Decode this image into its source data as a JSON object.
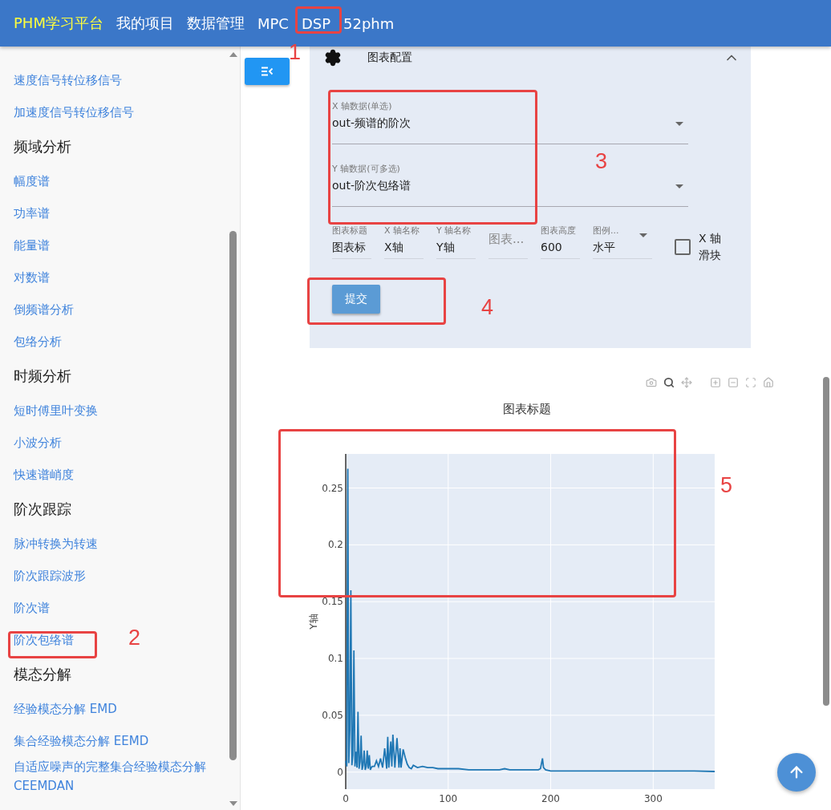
{
  "header": {
    "brand": "PHM学习平台",
    "nav": [
      {
        "label": "我的项目"
      },
      {
        "label": "数据管理"
      },
      {
        "label": "MPC"
      },
      {
        "label": "DSP"
      },
      {
        "label": "52phm"
      }
    ]
  },
  "sidebar": {
    "items": [
      {
        "kind": "link",
        "label": "速度信号转位移信号"
      },
      {
        "kind": "link",
        "label": "加速度信号转位移信号"
      },
      {
        "kind": "heading",
        "label": "频域分析"
      },
      {
        "kind": "link",
        "label": "幅度谱"
      },
      {
        "kind": "link",
        "label": "功率谱"
      },
      {
        "kind": "link",
        "label": "能量谱"
      },
      {
        "kind": "link",
        "label": "对数谱"
      },
      {
        "kind": "link",
        "label": "倒频谱分析"
      },
      {
        "kind": "link",
        "label": "包络分析"
      },
      {
        "kind": "heading",
        "label": "时频分析"
      },
      {
        "kind": "link",
        "label": "短时傅里叶变换"
      },
      {
        "kind": "link",
        "label": "小波分析"
      },
      {
        "kind": "link",
        "label": "快速谱峭度"
      },
      {
        "kind": "heading",
        "label": "阶次跟踪"
      },
      {
        "kind": "link",
        "label": "脉冲转换为转速"
      },
      {
        "kind": "link",
        "label": "阶次跟踪波形"
      },
      {
        "kind": "link",
        "label": "阶次谱"
      },
      {
        "kind": "link",
        "label": "阶次包络谱"
      },
      {
        "kind": "heading",
        "label": "模态分解"
      },
      {
        "kind": "link",
        "label": "经验模态分解 EMD"
      },
      {
        "kind": "link",
        "label": "集合经验模态分解 EEMD"
      },
      {
        "kind": "link",
        "label": "自适应噪声的完整集合经验模态分解 CEEMDAN"
      }
    ]
  },
  "config_panel": {
    "title": "图表配置",
    "expanded": true,
    "x_select": {
      "label": "X 轴数据(单选)",
      "value": "out-频谱的阶次"
    },
    "y_select": {
      "label": "Y 轴数据(可多选)",
      "value": "out-阶次包络谱"
    },
    "fields": [
      {
        "kind": "text",
        "label": "图表标题",
        "value": "图表标"
      },
      {
        "kind": "text",
        "label": "X 轴名称",
        "value": "X轴"
      },
      {
        "kind": "text",
        "label": "Y 轴名称",
        "value": "Y轴"
      },
      {
        "kind": "text",
        "label": "图表..."
      },
      {
        "kind": "text",
        "label": "图表高度",
        "value": "600"
      },
      {
        "kind": "select",
        "label": "图例...",
        "value": "水平"
      }
    ],
    "checkbox": {
      "label": "X 轴滑块",
      "checked": false
    },
    "submit": "提交"
  },
  "chart": {
    "chart_data": {
      "type": "line",
      "grid": true,
      "title": "图表标题",
      "ylabel": "Y轴",
      "xlim": [
        0,
        360
      ],
      "ylim": [
        -0.015,
        0.28
      ],
      "xticks": [
        0,
        100,
        200,
        300
      ],
      "yticks": [
        0,
        0.05,
        0.1,
        0.15,
        0.2,
        0.25
      ],
      "x": [
        0,
        1,
        2,
        3,
        4,
        5,
        6,
        7,
        8,
        9,
        10,
        11,
        12,
        13,
        14,
        15,
        16,
        17,
        18,
        19,
        20,
        21,
        22,
        23,
        24,
        25,
        26,
        28,
        30,
        32,
        34,
        36,
        38,
        40,
        41,
        42,
        44,
        45,
        46,
        48,
        50,
        52,
        53,
        54,
        56,
        58,
        60,
        62,
        64,
        66,
        70,
        75,
        80,
        85,
        90,
        100,
        110,
        120,
        130,
        140,
        150,
        155,
        160,
        170,
        180,
        188,
        190,
        192,
        193,
        195,
        200,
        210,
        220,
        240,
        260,
        280,
        300,
        320,
        340,
        360
      ],
      "series": [
        {
          "color": "#1f77b4",
          "values": [
            0.01,
            0.005,
            0.267,
            0.008,
            0.037,
            0.16,
            0.006,
            0.015,
            0.107,
            0.005,
            0.018,
            0.004,
            0.053,
            0.003,
            0.009,
            0.032,
            0.002,
            0.006,
            0.019,
            0.002,
            0.005,
            0.019,
            0.003,
            0.015,
            0.002,
            0.004,
            0.005,
            0.005,
            0.01,
            0.005,
            0.012,
            0.004,
            0.021,
            0.003,
            0.031,
            0.004,
            0.027,
            0.005,
            0.033,
            0.004,
            0.03,
            0.004,
            0.021,
            0.004,
            0.02,
            0.013,
            0.007,
            0.004,
            0.003,
            0.006,
            0.004,
            0.005,
            0.004,
            0.004,
            0.003,
            0.003,
            0.003,
            0.002,
            0.002,
            0.002,
            0.002,
            0.003,
            0.002,
            0.002,
            0.002,
            0.002,
            0.003,
            0.012,
            0.004,
            0.002,
            0.001,
            0.001,
            0.001,
            0.001,
            0.001,
            0.001,
            0.001,
            0.001,
            0.001,
            0.0005
          ]
        }
      ]
    }
  },
  "annotations": [
    {
      "label": "1",
      "color": "#e84343"
    },
    {
      "label": "2",
      "color": "#e84343"
    },
    {
      "label": "3",
      "color": "#e84343"
    },
    {
      "label": "4",
      "color": "#e84343"
    },
    {
      "label": "5",
      "color": "#e84343"
    }
  ]
}
